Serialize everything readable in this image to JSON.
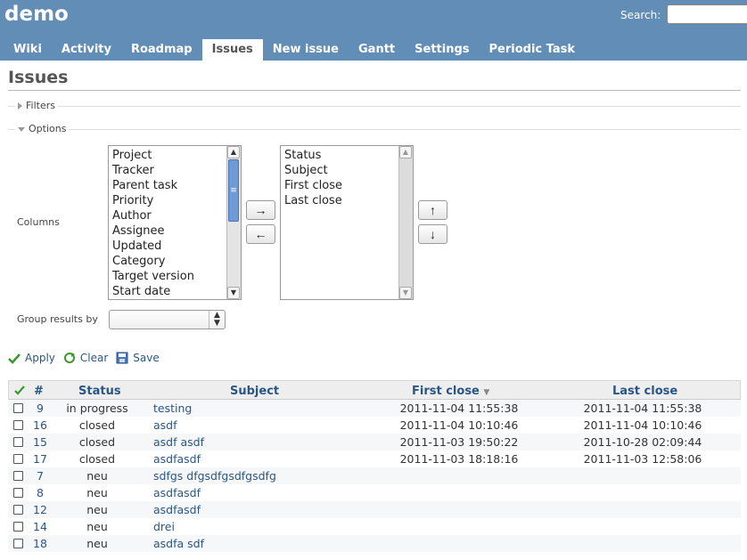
{
  "header": {
    "title": "demo",
    "search_label": "Search:",
    "search_value": "",
    "tabs": [
      {
        "label": "Wiki"
      },
      {
        "label": "Activity"
      },
      {
        "label": "Roadmap"
      },
      {
        "label": "Issues",
        "selected": true
      },
      {
        "label": "New issue"
      },
      {
        "label": "Gantt"
      },
      {
        "label": "Settings"
      },
      {
        "label": "Periodic Task"
      }
    ]
  },
  "page": {
    "title": "Issues"
  },
  "filters": {
    "legend": "Filters",
    "collapsed": true
  },
  "options": {
    "legend": "Options",
    "columns_label": "Columns",
    "available_columns": [
      "Project",
      "Tracker",
      "Parent task",
      "Priority",
      "Author",
      "Assignee",
      "Updated",
      "Category",
      "Target version",
      "Start date"
    ],
    "selected_columns": [
      "Status",
      "Subject",
      "First close",
      "Last close"
    ],
    "add_button": "→",
    "remove_button": "←",
    "up_button": "↑",
    "down_button": "↓",
    "group_label": "Group results by",
    "group_value": ""
  },
  "actions": {
    "apply": "Apply",
    "clear": "Clear",
    "save": "Save"
  },
  "table": {
    "headers": {
      "id": "#",
      "status": "Status",
      "subject": "Subject",
      "first_close": "First close",
      "last_close": "Last close"
    },
    "sort_column": "First close",
    "rows": [
      {
        "id": "9",
        "status": "in progress",
        "subject": "testing",
        "first_close": "2011-11-04 11:55:38",
        "last_close": "2011-11-04 11:55:38"
      },
      {
        "id": "16",
        "status": "closed",
        "subject": "asdf",
        "first_close": "2011-11-04 10:10:46",
        "last_close": "2011-11-04 10:10:46"
      },
      {
        "id": "15",
        "status": "closed",
        "subject": "asdf asdf",
        "first_close": "2011-11-03 19:50:22",
        "last_close": "2011-10-28 02:09:44"
      },
      {
        "id": "17",
        "status": "closed",
        "subject": "asdfasdf",
        "first_close": "2011-11-03 18:18:16",
        "last_close": "2011-11-03 12:58:06"
      },
      {
        "id": "7",
        "status": "neu",
        "subject": "sdfgs dfgsdfgsdfgsdfg",
        "first_close": "",
        "last_close": ""
      },
      {
        "id": "8",
        "status": "neu",
        "subject": "asdfasdf",
        "first_close": "",
        "last_close": ""
      },
      {
        "id": "12",
        "status": "neu",
        "subject": "asdfasdf",
        "first_close": "",
        "last_close": ""
      },
      {
        "id": "14",
        "status": "neu",
        "subject": "drei",
        "first_close": "",
        "last_close": ""
      },
      {
        "id": "18",
        "status": "neu",
        "subject": "asdfa sdf",
        "first_close": "",
        "last_close": ""
      }
    ]
  },
  "colors": {
    "header_bg": "#628db6",
    "link": "#2a5685",
    "row_alt": "#f6f7f9"
  }
}
